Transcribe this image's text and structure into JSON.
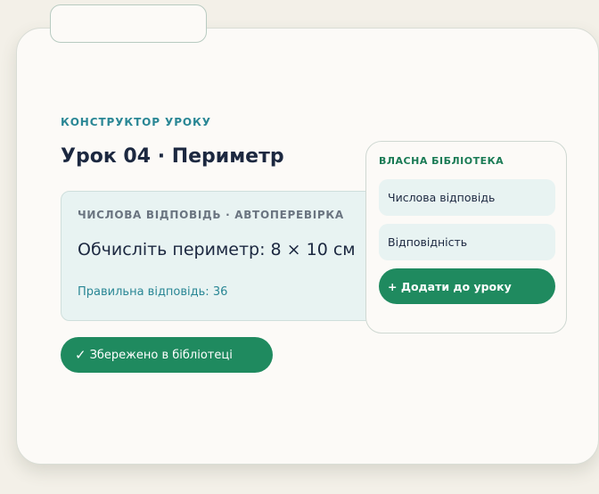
{
  "builder": {
    "kicker": "КОНСТРУКТОР УРОКУ",
    "lesson_title": "Урок 04 · Периметр"
  },
  "question": {
    "type_label": "ЧИСЛОВА ВІДПОВІДЬ · АВТОПЕРЕВІРКА",
    "prompt": "Обчисліть периметр: 8 × 10 см",
    "answer": "Правильна відповідь: 36"
  },
  "saved_button": {
    "icon": "✓",
    "label": "Збережено в бібліотеці"
  },
  "library": {
    "title": "ВЛАСНА БІБЛІОТЕКА",
    "items": [
      {
        "label": "Числова відповідь"
      },
      {
        "label": "Відповідність"
      }
    ],
    "add_button": "+ Додати до уроку"
  },
  "colors": {
    "accent_green": "#1f8a5f",
    "accent_teal": "#2a8795",
    "panel_tint": "#e8f3f2"
  }
}
